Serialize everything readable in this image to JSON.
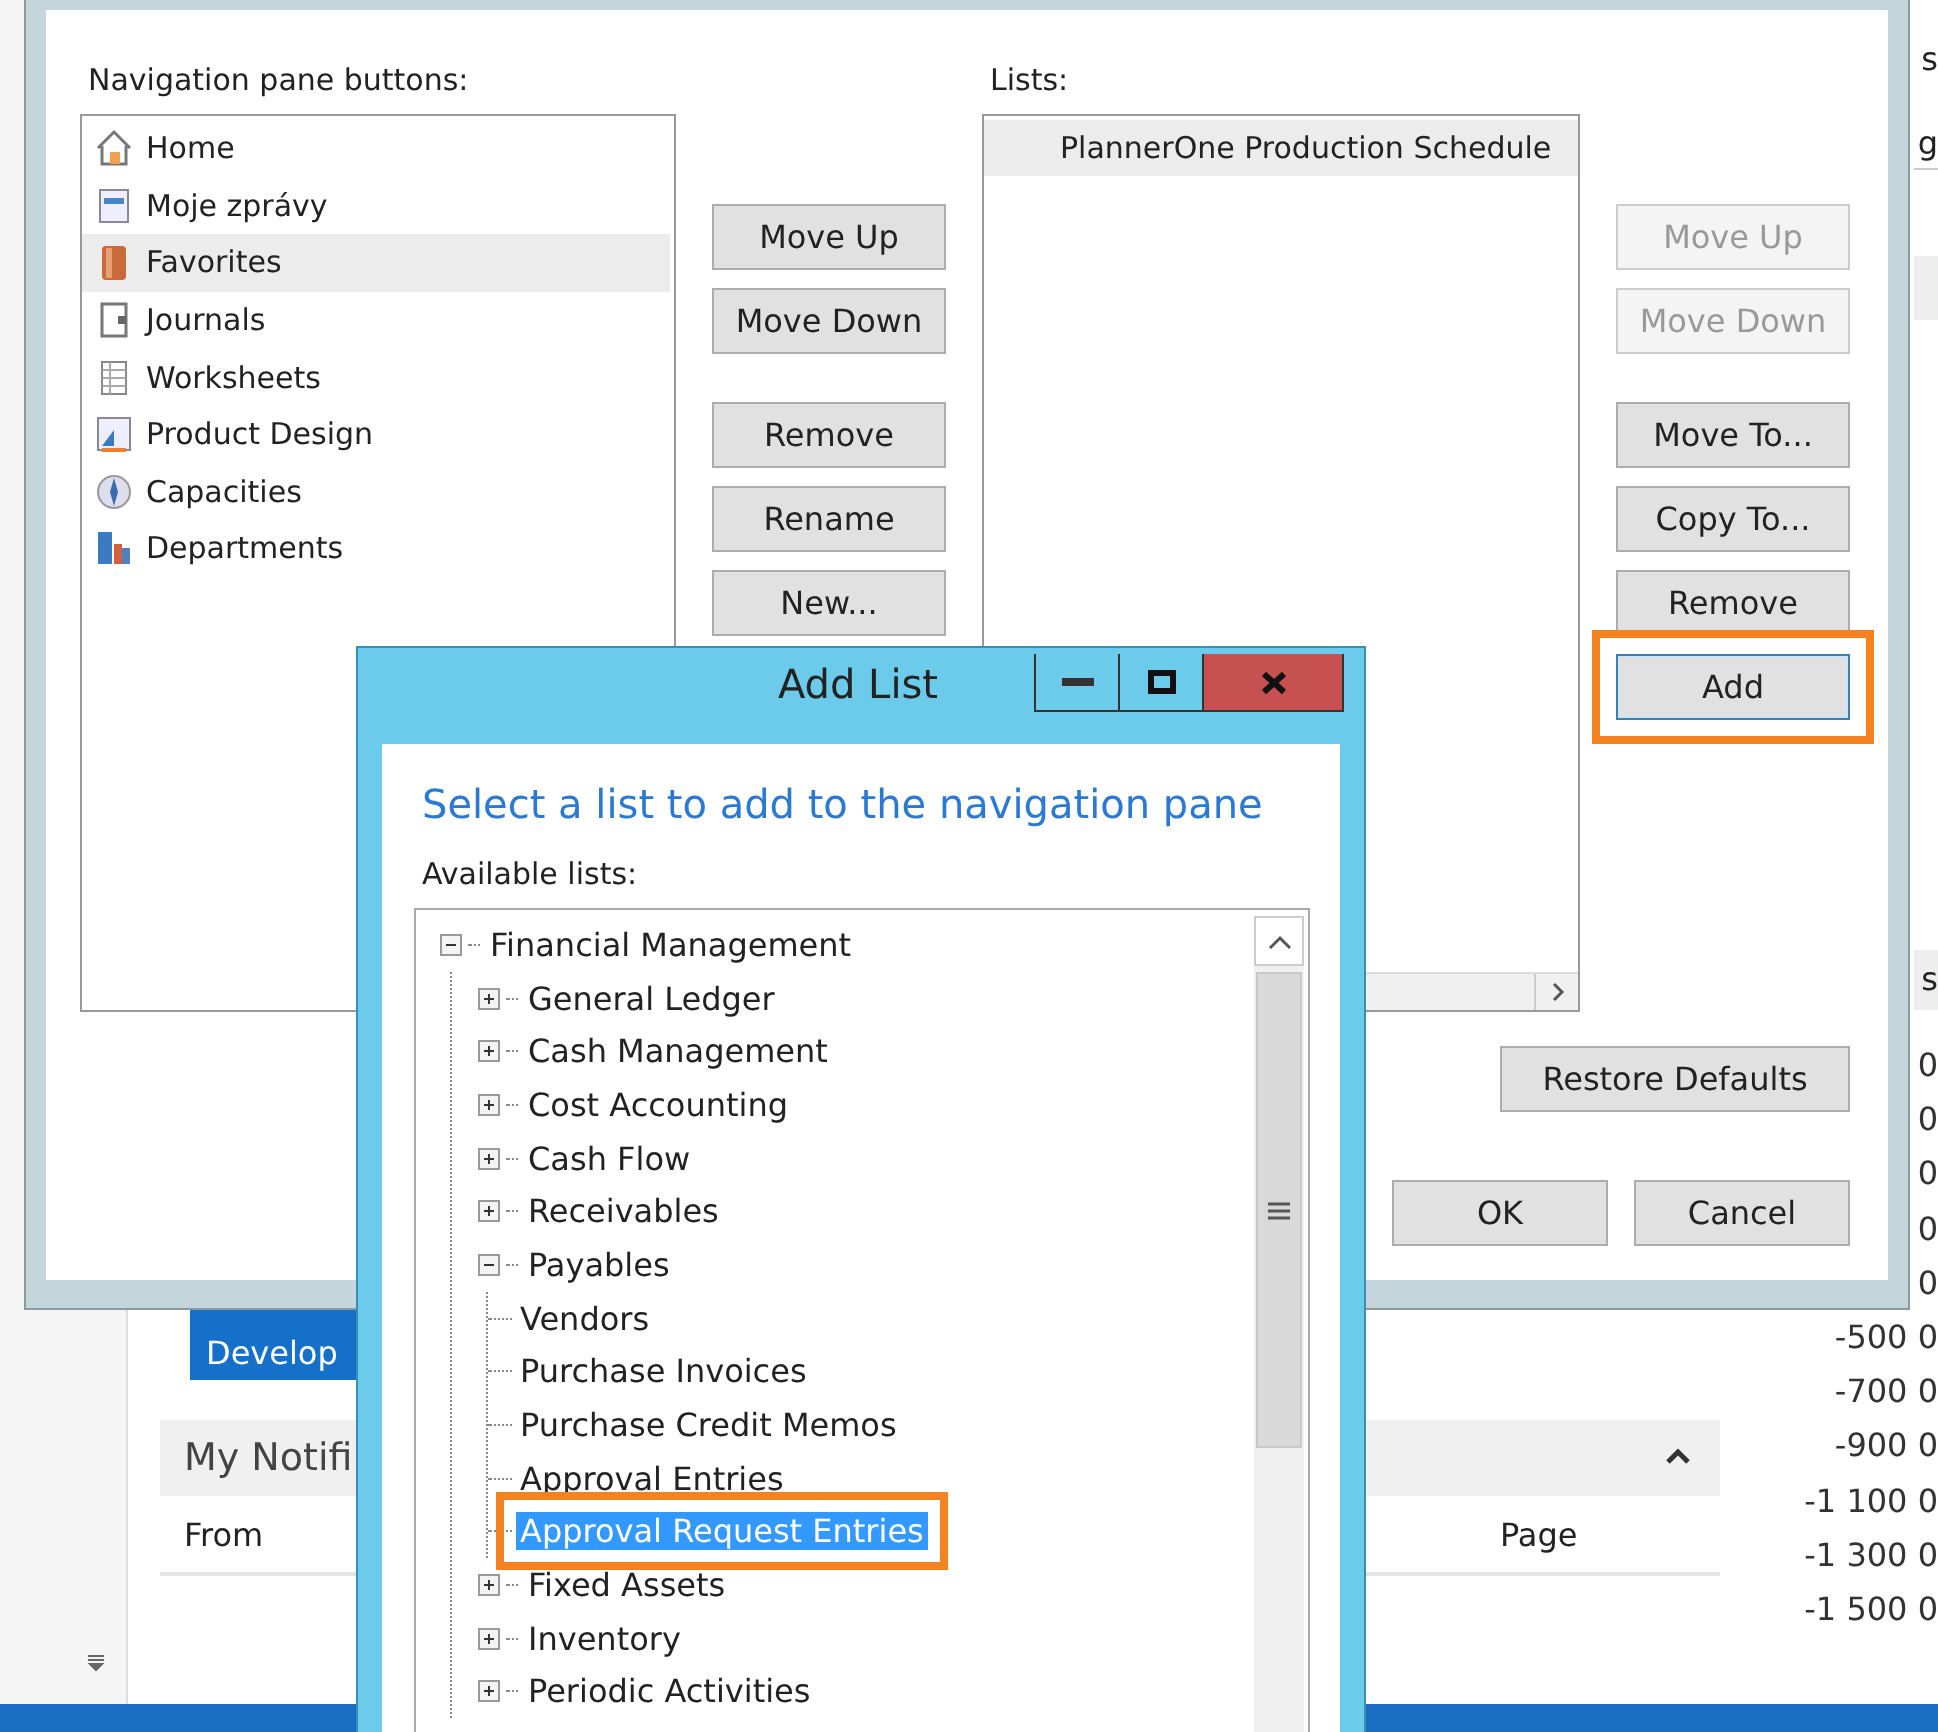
{
  "background": {
    "right_pane": {
      "header": "s",
      "field": "g",
      "band": "s",
      "amounts": [
        "0",
        "0",
        "0",
        "0",
        "0",
        "-500 0",
        "-700 0",
        "-900 0",
        "-1 100 0",
        "-1 300 0",
        "-1 500 0"
      ]
    },
    "tile_lines": [
      "Develop"
    ],
    "notifications": {
      "title": "My Notifi",
      "columns": [
        "From",
        "Page"
      ]
    }
  },
  "main_dialog": {
    "nav_label": "Navigation pane buttons:",
    "nav_items": [
      {
        "label": "Home",
        "selected": false
      },
      {
        "label": "Moje zprávy",
        "selected": false
      },
      {
        "label": "Favorites",
        "selected": true
      },
      {
        "label": "Journals",
        "selected": false
      },
      {
        "label": "Worksheets",
        "selected": false
      },
      {
        "label": "Product Design",
        "selected": false
      },
      {
        "label": "Capacities",
        "selected": false
      },
      {
        "label": "Departments",
        "selected": false
      }
    ],
    "nav_button_groups": [
      [
        {
          "label": "Move Up",
          "disabled": false
        },
        {
          "label": "Move Down",
          "disabled": false
        }
      ],
      [
        {
          "label": "Remove",
          "disabled": false
        },
        {
          "label": "Rename",
          "disabled": false
        },
        {
          "label": "New...",
          "disabled": false
        }
      ]
    ],
    "lists_label": "Lists:",
    "lists": [
      {
        "label": "PlannerOne Production Schedule",
        "selected": true
      }
    ],
    "list_button_groups": [
      [
        {
          "label": "Move Up",
          "disabled": true,
          "highlighted": false
        },
        {
          "label": "Move Down",
          "disabled": true,
          "highlighted": false
        }
      ],
      [
        {
          "label": "Move To...",
          "disabled": false,
          "highlighted": false
        },
        {
          "label": "Copy To...",
          "disabled": false,
          "highlighted": false
        },
        {
          "label": "Remove",
          "disabled": false,
          "highlighted": false
        },
        {
          "label": "Add",
          "disabled": false,
          "highlighted": true
        }
      ]
    ],
    "restore_button": "Restore Defaults",
    "ok_button": "OK",
    "cancel_button": "Cancel"
  },
  "add_list_dialog": {
    "title": "Add List",
    "heading": "Select a list to add to the navigation pane",
    "tree_label": "Available lists:",
    "tree": [
      {
        "label": "Financial Management",
        "selected": false,
        "highlighted": false,
        "expanded": true,
        "children": [
          {
            "label": "General Ledger",
            "selected": false,
            "highlighted": false,
            "expanded": false
          },
          {
            "label": "Cash Management",
            "selected": false,
            "highlighted": false,
            "expanded": false
          },
          {
            "label": "Cost Accounting",
            "selected": false,
            "highlighted": false,
            "expanded": false
          },
          {
            "label": "Cash Flow",
            "selected": false,
            "highlighted": false,
            "expanded": false
          },
          {
            "label": "Receivables",
            "selected": false,
            "highlighted": false,
            "expanded": false
          },
          {
            "label": "Payables",
            "selected": false,
            "highlighted": false,
            "expanded": true,
            "children": [
              {
                "label": "Vendors",
                "selected": false,
                "highlighted": false
              },
              {
                "label": "Purchase Invoices",
                "selected": false,
                "highlighted": false
              },
              {
                "label": "Purchase Credit Memos",
                "selected": false,
                "highlighted": false
              },
              {
                "label": "Approval Entries",
                "selected": false,
                "highlighted": false
              },
              {
                "label": "Approval Request Entries",
                "selected": true,
                "highlighted": true
              }
            ]
          },
          {
            "label": "Fixed Assets",
            "selected": false,
            "highlighted": false,
            "expanded": false
          },
          {
            "label": "Inventory",
            "selected": false,
            "highlighted": false,
            "expanded": false
          },
          {
            "label": "Periodic Activities",
            "selected": false,
            "highlighted": false,
            "expanded": false
          }
        ]
      }
    ]
  }
}
